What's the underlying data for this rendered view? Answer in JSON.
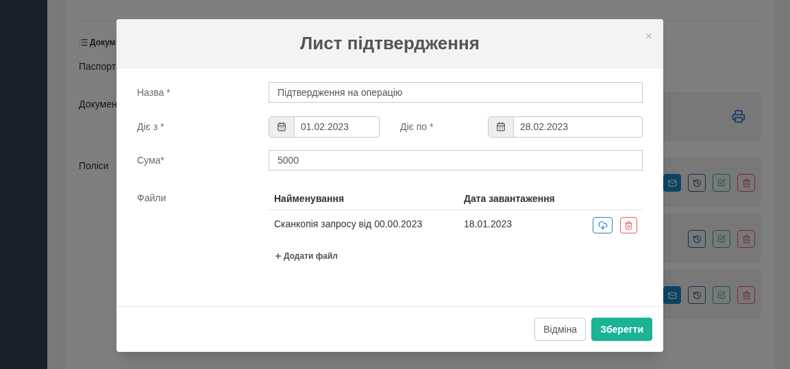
{
  "background_page": {
    "section_title": "Докум",
    "passport_label": "Паспорт",
    "documents_label": "Докумен",
    "policies_label": "Поліси",
    "policy_rows": [
      {
        "buttons": [
          {
            "kind": "mail"
          },
          {
            "kind": "history"
          },
          {
            "kind": "edit"
          },
          {
            "kind": "delete"
          }
        ]
      },
      {
        "buttons": [
          {
            "kind": "history"
          },
          {
            "kind": "edit"
          },
          {
            "kind": "delete"
          }
        ]
      },
      {
        "buttons": [
          {
            "kind": "mail"
          },
          {
            "kind": "history"
          },
          {
            "kind": "edit"
          },
          {
            "kind": "delete"
          }
        ]
      }
    ]
  },
  "modal": {
    "title": "Лист підтвердження",
    "close": "×",
    "name_field": {
      "label": "Назва *",
      "value": "Підтвердження на операцію"
    },
    "valid_from": {
      "label": "Діє з *",
      "value": "01.02.2023"
    },
    "valid_to": {
      "label": "Діє по *",
      "value": "28.02.2023"
    },
    "amount": {
      "label": "Сума*",
      "value": "5000"
    },
    "files": {
      "label": "Файли",
      "columns": [
        "Найменування",
        "Дата завантаження"
      ],
      "rows": [
        {
          "name": "Сканкопія запросу від 00.00.2023",
          "date": "18.01.2023"
        }
      ],
      "add_file": "Додати файл"
    },
    "buttons": [
      {
        "label": "Відміна",
        "kind": "secondary"
      },
      {
        "label": "Зберегти",
        "kind": "primary"
      }
    ]
  }
}
